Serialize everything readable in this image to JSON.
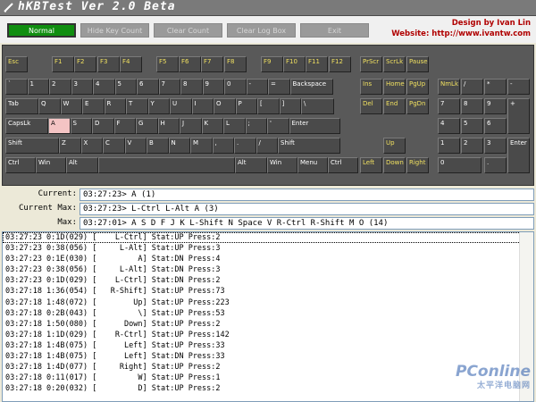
{
  "window": {
    "title": "hKBTest Ver 2.0 Beta"
  },
  "toolbar": {
    "normal_label": "Normal",
    "hide_key_count_label": "Hide Key Count",
    "clear_count_label": "Clear Count",
    "clear_log_label": "Clear Log Box",
    "exit_label": "Exit"
  },
  "credits": {
    "design": "Design by Ivan Lin",
    "website": "Website: http://www.ivantw.com"
  },
  "status": {
    "current_label": "Current:",
    "current_value": "03:27:23> A (1)",
    "current_max_label": "Current Max:",
    "current_max_value": "03:27:23> L-Ctrl L-Alt A (3)",
    "max_label": "Max:",
    "max_value": "03:27:01> A S D F J K L-Shift N Space V R-Ctrl R-Shift M O (14)"
  },
  "keyboard": {
    "keys": [
      "Esc",
      "F1",
      "F2",
      "F3",
      "F4",
      "F5",
      "F6",
      "F7",
      "F8",
      "F9",
      "F10",
      "F11",
      "F12",
      "PrScr",
      "ScrLk",
      "Pause",
      "`",
      "1",
      "2",
      "3",
      "4",
      "5",
      "6",
      "7",
      "8",
      "9",
      "0",
      "-",
      "=",
      "Backspace",
      "Ins",
      "Home",
      "PgUp",
      "NmLk",
      "/",
      "*",
      "-",
      "Tab",
      "Q",
      "W",
      "E",
      "R",
      "T",
      "Y",
      "U",
      "I",
      "O",
      "P",
      "[",
      "]",
      "\\",
      "Del",
      "End",
      "PgDn",
      "7",
      "8",
      "9",
      "+",
      "CapsLk",
      "A",
      "S",
      "D",
      "F",
      "G",
      "H",
      "J",
      "K",
      "L",
      ";",
      "'",
      "Enter",
      "4",
      "5",
      "6",
      "Shift",
      "Z",
      "X",
      "C",
      "V",
      "B",
      "N",
      "M",
      ",",
      ".",
      "/",
      "Shift",
      "Up",
      "1",
      "2",
      "3",
      "Enter",
      "Ctrl",
      "Win",
      "Alt",
      "Alt",
      "Win",
      "Menu",
      "Ctrl",
      "Left",
      "Down",
      "Right",
      "0",
      "."
    ],
    "pressed": "A"
  },
  "log": [
    "03:27:23 0:1D(029) [    L-Ctrl] Stat:UP Press:2",
    "03:27:23 0:38(056) [     L-Alt] Stat:UP Press:3",
    "03:27:23 0:1E(030) [         A] Stat:DN Press:4",
    "03:27:23 0:38(056) [     L-Alt] Stat:DN Press:3",
    "03:27:23 0:1D(029) [    L-Ctrl] Stat:DN Press:2",
    "03:27:18 1:36(054) [   R-Shift] Stat:UP Press:73",
    "03:27:18 1:48(072) [        Up] Stat:UP Press:223",
    "03:27:18 0:2B(043) [         \\] Stat:UP Press:53",
    "03:27:18 1:50(080) [      Down] Stat:UP Press:2",
    "03:27:18 1:1D(029) [    R-Ctrl] Stat:UP Press:142",
    "03:27:18 1:4B(075) [      Left] Stat:UP Press:33",
    "03:27:18 1:4B(075) [      Left] Stat:DN Press:33",
    "03:27:18 1:4D(077) [     Right] Stat:UP Press:2",
    "03:27:18 0:11(017) [         W] Stat:UP Press:1",
    "03:27:18 0:20(032) [         D] Stat:UP Press:2"
  ],
  "watermark": {
    "brand": "PConline",
    "sub": "太平洋电脑网"
  },
  "colors": {
    "accent_green": "#108e10",
    "credit_red": "#b00000",
    "fkey_yellow": "#f0e060",
    "pressed_pink": "#f4c4c4"
  }
}
